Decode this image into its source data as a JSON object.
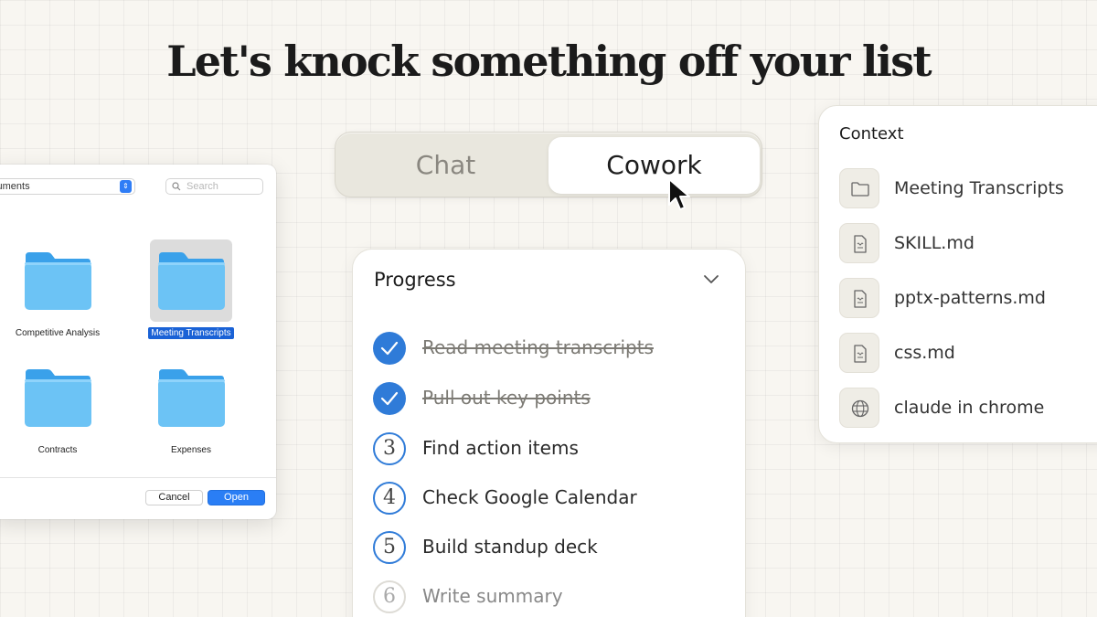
{
  "headline": "Let's knock something off your list",
  "file_dialog": {
    "location": "cuments",
    "search_placeholder": "Search",
    "folders": [
      {
        "name": "Competitive Analysis",
        "selected": false
      },
      {
        "name": "Meeting Transcripts",
        "selected": true
      },
      {
        "name": "Contracts",
        "selected": false
      },
      {
        "name": "Expenses",
        "selected": false
      }
    ],
    "cancel_label": "Cancel",
    "open_label": "Open",
    "folder_color": "#6cc3f5"
  },
  "mode_toggle": {
    "options": [
      "Chat",
      "Cowork"
    ],
    "selected": "Cowork"
  },
  "progress": {
    "title": "Progress",
    "steps": [
      {
        "marker": "✓",
        "label": "Read meeting transcripts",
        "status": "done"
      },
      {
        "marker": "✓",
        "label": "Pull out key points",
        "status": "done"
      },
      {
        "marker": "3",
        "label": "Find action items",
        "status": "pending"
      },
      {
        "marker": "4",
        "label": "Check Google Calendar",
        "status": "pending"
      },
      {
        "marker": "5",
        "label": "Build standup deck",
        "status": "pending"
      },
      {
        "marker": "6",
        "label": "Write summary",
        "status": "upcoming"
      }
    ],
    "accent_color": "#2f7bd8"
  },
  "context": {
    "title": "Context",
    "items": [
      {
        "icon": "folder-icon",
        "label": "Meeting Transcripts"
      },
      {
        "icon": "document-icon",
        "label": "SKILL.md"
      },
      {
        "icon": "document-icon",
        "label": "pptx-patterns.md"
      },
      {
        "icon": "document-icon",
        "label": "css.md"
      },
      {
        "icon": "globe-icon",
        "label": "claude in chrome"
      }
    ]
  }
}
